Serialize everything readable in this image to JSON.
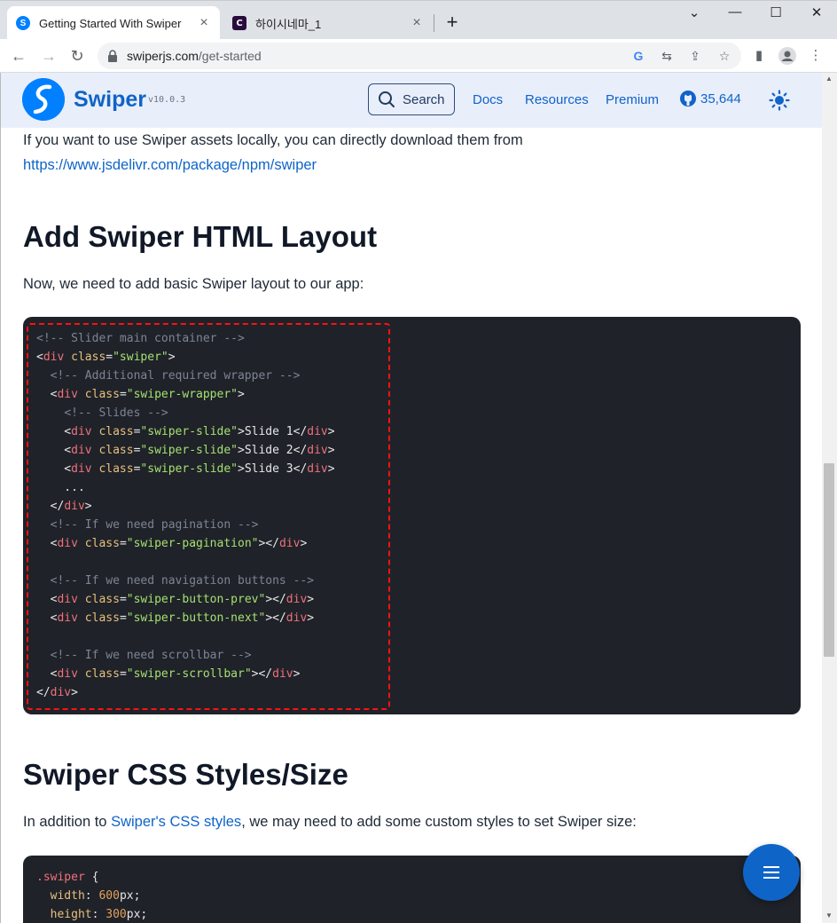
{
  "browser": {
    "tabs": [
      {
        "title": "Getting Started With Swiper",
        "active": true,
        "favicon": "swiper-favicon-icon"
      },
      {
        "title": "하이시네마_1",
        "active": false,
        "favicon": "c-favicon-icon"
      }
    ],
    "new_tab": "+",
    "window_controls": {
      "minimize": "—",
      "maximize": "☐",
      "close": "✕",
      "tab_list": "⌄"
    },
    "url_host": "swiperjs.com",
    "url_path": "/get-started"
  },
  "site_nav": {
    "brand": "Swiper",
    "version": "v10.0.3",
    "search_label": "Search",
    "links": [
      "Docs",
      "Resources",
      "Premium"
    ],
    "github_count": "35,644"
  },
  "content": {
    "intro_text": "If you want to use Swiper assets locally, you can directly download them from",
    "intro_link": "https://www.jsdelivr.com/package/npm/swiper",
    "heading_html_layout": "Add Swiper HTML Layout",
    "html_layout_text": "Now, we need to add basic Swiper layout to our app:",
    "heading_css": "Swiper CSS Styles/Size",
    "css_text_before": "In addition to ",
    "css_text_link": "Swiper's CSS styles",
    "css_text_after": ", we may need to add some custom styles to set Swiper size:"
  },
  "html_code_lines": [
    [
      [
        "c-cm",
        "<!-- Slider main container -->"
      ]
    ],
    [
      [
        "c-pl",
        "<"
      ],
      [
        "c-tg",
        "div"
      ],
      [
        "c-pl",
        " "
      ],
      [
        "c-at",
        "class"
      ],
      [
        "c-pl",
        "="
      ],
      [
        "c-st",
        "\"swiper\""
      ],
      [
        "c-pl",
        ">"
      ]
    ],
    [
      [
        "c-pl",
        "  "
      ],
      [
        "c-cm",
        "<!-- Additional required wrapper -->"
      ]
    ],
    [
      [
        "c-pl",
        "  <"
      ],
      [
        "c-tg",
        "div"
      ],
      [
        "c-pl",
        " "
      ],
      [
        "c-at",
        "class"
      ],
      [
        "c-pl",
        "="
      ],
      [
        "c-st",
        "\"swiper-wrapper\""
      ],
      [
        "c-pl",
        ">"
      ]
    ],
    [
      [
        "c-pl",
        "    "
      ],
      [
        "c-cm",
        "<!-- Slides -->"
      ]
    ],
    [
      [
        "c-pl",
        "    <"
      ],
      [
        "c-tg",
        "div"
      ],
      [
        "c-pl",
        " "
      ],
      [
        "c-at",
        "class"
      ],
      [
        "c-pl",
        "="
      ],
      [
        "c-st",
        "\"swiper-slide\""
      ],
      [
        "c-pl",
        ">Slide 1</"
      ],
      [
        "c-tg",
        "div"
      ],
      [
        "c-pl",
        ">"
      ]
    ],
    [
      [
        "c-pl",
        "    <"
      ],
      [
        "c-tg",
        "div"
      ],
      [
        "c-pl",
        " "
      ],
      [
        "c-at",
        "class"
      ],
      [
        "c-pl",
        "="
      ],
      [
        "c-st",
        "\"swiper-slide\""
      ],
      [
        "c-pl",
        ">Slide 2</"
      ],
      [
        "c-tg",
        "div"
      ],
      [
        "c-pl",
        ">"
      ]
    ],
    [
      [
        "c-pl",
        "    <"
      ],
      [
        "c-tg",
        "div"
      ],
      [
        "c-pl",
        " "
      ],
      [
        "c-at",
        "class"
      ],
      [
        "c-pl",
        "="
      ],
      [
        "c-st",
        "\"swiper-slide\""
      ],
      [
        "c-pl",
        ">Slide 3</"
      ],
      [
        "c-tg",
        "div"
      ],
      [
        "c-pl",
        ">"
      ]
    ],
    [
      [
        "c-pl",
        "    ..."
      ]
    ],
    [
      [
        "c-pl",
        "  </"
      ],
      [
        "c-tg",
        "div"
      ],
      [
        "c-pl",
        ">"
      ]
    ],
    [
      [
        "c-pl",
        "  "
      ],
      [
        "c-cm",
        "<!-- If we need pagination -->"
      ]
    ],
    [
      [
        "c-pl",
        "  <"
      ],
      [
        "c-tg",
        "div"
      ],
      [
        "c-pl",
        " "
      ],
      [
        "c-at",
        "class"
      ],
      [
        "c-pl",
        "="
      ],
      [
        "c-st",
        "\"swiper-pagination\""
      ],
      [
        "c-pl",
        "></"
      ],
      [
        "c-tg",
        "div"
      ],
      [
        "c-pl",
        ">"
      ]
    ],
    [],
    [
      [
        "c-pl",
        "  "
      ],
      [
        "c-cm",
        "<!-- If we need navigation buttons -->"
      ]
    ],
    [
      [
        "c-pl",
        "  <"
      ],
      [
        "c-tg",
        "div"
      ],
      [
        "c-pl",
        " "
      ],
      [
        "c-at",
        "class"
      ],
      [
        "c-pl",
        "="
      ],
      [
        "c-st",
        "\"swiper-button-prev\""
      ],
      [
        "c-pl",
        "></"
      ],
      [
        "c-tg",
        "div"
      ],
      [
        "c-pl",
        ">"
      ]
    ],
    [
      [
        "c-pl",
        "  <"
      ],
      [
        "c-tg",
        "div"
      ],
      [
        "c-pl",
        " "
      ],
      [
        "c-at",
        "class"
      ],
      [
        "c-pl",
        "="
      ],
      [
        "c-st",
        "\"swiper-button-next\""
      ],
      [
        "c-pl",
        "></"
      ],
      [
        "c-tg",
        "div"
      ],
      [
        "c-pl",
        ">"
      ]
    ],
    [],
    [
      [
        "c-pl",
        "  "
      ],
      [
        "c-cm",
        "<!-- If we need scrollbar -->"
      ]
    ],
    [
      [
        "c-pl",
        "  <"
      ],
      [
        "c-tg",
        "div"
      ],
      [
        "c-pl",
        " "
      ],
      [
        "c-at",
        "class"
      ],
      [
        "c-pl",
        "="
      ],
      [
        "c-st",
        "\"swiper-scrollbar\""
      ],
      [
        "c-pl",
        "></"
      ],
      [
        "c-tg",
        "div"
      ],
      [
        "c-pl",
        ">"
      ]
    ],
    [
      [
        "c-pl",
        "</"
      ],
      [
        "c-tg",
        "div"
      ],
      [
        "c-pl",
        ">"
      ]
    ]
  ],
  "css_code_lines": [
    [
      [
        "c-sel",
        ".swiper"
      ],
      [
        "c-pl",
        " {"
      ]
    ],
    [
      [
        "c-pl",
        "  "
      ],
      [
        "c-at",
        "width"
      ],
      [
        "c-pl",
        ": "
      ],
      [
        "c-num",
        "600"
      ],
      [
        "c-pl",
        "px;"
      ]
    ],
    [
      [
        "c-pl",
        "  "
      ],
      [
        "c-at",
        "height"
      ],
      [
        "c-pl",
        ": "
      ],
      [
        "c-num",
        "300"
      ],
      [
        "c-pl",
        "px;"
      ]
    ]
  ],
  "colors": {
    "accent": "#0f64c8",
    "nav_bg": "#e9eefb",
    "code_bg": "#1f2229",
    "highlight_border": "#ff1010"
  }
}
